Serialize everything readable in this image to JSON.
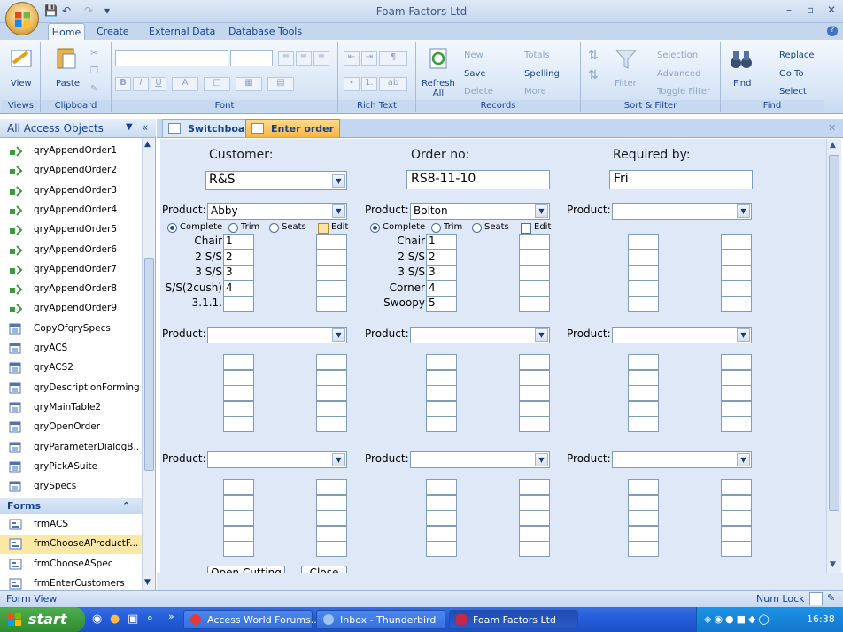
{
  "app": {
    "title": "Foam Factors Ltd"
  },
  "ribbon_tabs": [
    "Home",
    "Create",
    "External Data",
    "Database Tools"
  ],
  "ribbon": {
    "views": {
      "view_label": "View",
      "group": "Views"
    },
    "clipboard": {
      "paste_label": "Paste",
      "group": "Clipboard"
    },
    "font": {
      "group": "Font"
    },
    "rich_text": {
      "group": "Rich Text"
    },
    "records": {
      "refresh_label": "Refresh All",
      "new": "New",
      "save": "Save",
      "delete": "Delete",
      "totals": "Totals",
      "spelling": "Spelling",
      "more": "More",
      "group": "Records"
    },
    "sort_filter": {
      "filter": "Filter",
      "selection": "Selection",
      "advanced": "Advanced",
      "toggle_filter": "Toggle Filter",
      "group": "Sort & Filter"
    },
    "find": {
      "find": "Find",
      "replace": "Replace",
      "goto": "Go To",
      "select": "Select",
      "group": "Find"
    }
  },
  "nav": {
    "header": "All Access Objects",
    "items": [
      {
        "label": "qryAppendOrder1",
        "type": "append"
      },
      {
        "label": "qryAppendOrder2",
        "type": "append"
      },
      {
        "label": "qryAppendOrder3",
        "type": "append"
      },
      {
        "label": "qryAppendOrder4",
        "type": "append"
      },
      {
        "label": "qryAppendOrder5",
        "type": "append"
      },
      {
        "label": "qryAppendOrder6",
        "type": "append"
      },
      {
        "label": "qryAppendOrder7",
        "type": "append"
      },
      {
        "label": "qryAppendOrder8",
        "type": "append"
      },
      {
        "label": "qryAppendOrder9",
        "type": "append"
      },
      {
        "label": "CopyOfqrySpecs",
        "type": "query"
      },
      {
        "label": "qryACS",
        "type": "query"
      },
      {
        "label": "qryACS2",
        "type": "query"
      },
      {
        "label": "qryDescriptionForming",
        "type": "query"
      },
      {
        "label": "qryMainTable2",
        "type": "query"
      },
      {
        "label": "qryOpenOrder",
        "type": "query"
      },
      {
        "label": "qryParameterDialogB...",
        "type": "query"
      },
      {
        "label": "qryPickASuite",
        "type": "query"
      },
      {
        "label": "qrySpecs",
        "type": "query"
      }
    ],
    "forms_header": "Forms",
    "forms": [
      {
        "label": "frmACS",
        "selected": false
      },
      {
        "label": "frmChooseAProductF...",
        "selected": true
      },
      {
        "label": "frmChooseASpec",
        "selected": false
      },
      {
        "label": "frmEnterCustomers",
        "selected": false
      }
    ]
  },
  "doc_tabs": [
    {
      "label": "Switchboard",
      "active": false
    },
    {
      "label": "Enter order",
      "active": true
    }
  ],
  "form": {
    "customer_label": "Customer:",
    "customer_value": "R&S",
    "order_label": "Order no:",
    "order_value": "RS8-11-10",
    "required_label": "Required by:",
    "required_value": "Fri",
    "product_label": "Product:",
    "opt_complete": "Complete",
    "opt_trim": "Trim",
    "opt_seats": "Seats",
    "opt_edit": "Edit",
    "p1": {
      "name": "Abby",
      "rows": [
        {
          "label": "Chair",
          "value": "1"
        },
        {
          "label": "2 S/S",
          "value": "2"
        },
        {
          "label": "3 S/S",
          "value": "3"
        },
        {
          "label": "S/S(2cush)",
          "value": "4"
        },
        {
          "label": "3.1.1.",
          "value": ""
        }
      ]
    },
    "p2": {
      "name": "Bolton",
      "rows": [
        {
          "label": "Chair",
          "value": "1"
        },
        {
          "label": "2 S/S",
          "value": "2"
        },
        {
          "label": "3 S/S",
          "value": "3"
        },
        {
          "label": "Corner",
          "value": "4"
        },
        {
          "label": "Swoopy",
          "value": "5"
        }
      ]
    },
    "open_cutting": "Open Cutting",
    "close": "Close"
  },
  "status": {
    "left": "Form View",
    "num_lock": "Num Lock"
  },
  "taskbar": {
    "start": "start",
    "buttons": [
      "Access World Forums...",
      "Inbox - Thunderbird",
      "Foam Factors Ltd"
    ],
    "clock": "16:38"
  },
  "colors": {
    "accent": "#15428b",
    "form_bg": "#dfe8f6",
    "taskbar": "#245edb",
    "selected": "#fbe7a6"
  }
}
